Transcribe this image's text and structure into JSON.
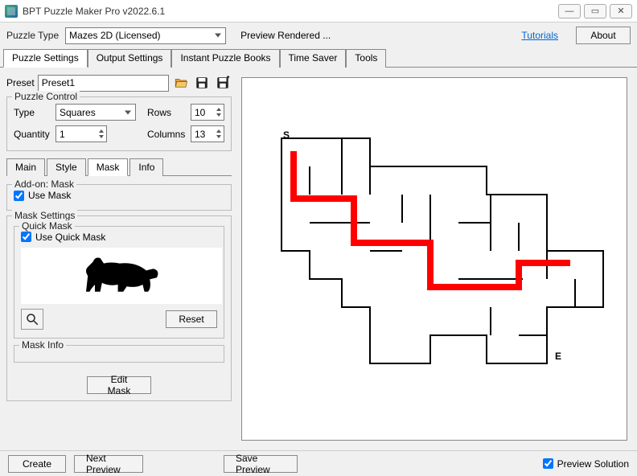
{
  "window": {
    "title": "BPT Puzzle Maker Pro v2022.6.1",
    "min": "—",
    "max": "▭",
    "close": "✕"
  },
  "toolbar": {
    "puzzle_type_label": "Puzzle Type",
    "puzzle_type_value": "Mazes 2D (Licensed)",
    "preview_text": "Preview Rendered ...",
    "tutorials": "Tutorials",
    "about": "About"
  },
  "tabs": [
    "Puzzle Settings",
    "Output Settings",
    "Instant Puzzle Books",
    "Time Saver",
    "Tools"
  ],
  "left": {
    "preset_label": "Preset",
    "preset_value": "Preset1",
    "control": {
      "legend": "Puzzle Control",
      "type_label": "Type",
      "type_value": "Squares",
      "rows_label": "Rows",
      "rows_value": "10",
      "qty_label": "Quantity",
      "qty_value": "1",
      "cols_label": "Columns",
      "cols_value": "13"
    },
    "subtabs": [
      "Main",
      "Style",
      "Mask",
      "Info"
    ],
    "addon": {
      "legend": "Add-on: Mask",
      "use_mask": "Use Mask"
    },
    "mask_settings": {
      "legend": "Mask Settings",
      "quick_legend": "Quick Mask",
      "use_quick": "Use Quick Mask",
      "reset": "Reset",
      "mask_info_legend": "Mask Info",
      "edit_mask": "Edit Mask"
    }
  },
  "maze": {
    "start": "S",
    "end": "E"
  },
  "bottom": {
    "create": "Create",
    "next_preview": "Next Preview",
    "save_preview": "Save Preview",
    "preview_solution": "Preview Solution"
  }
}
